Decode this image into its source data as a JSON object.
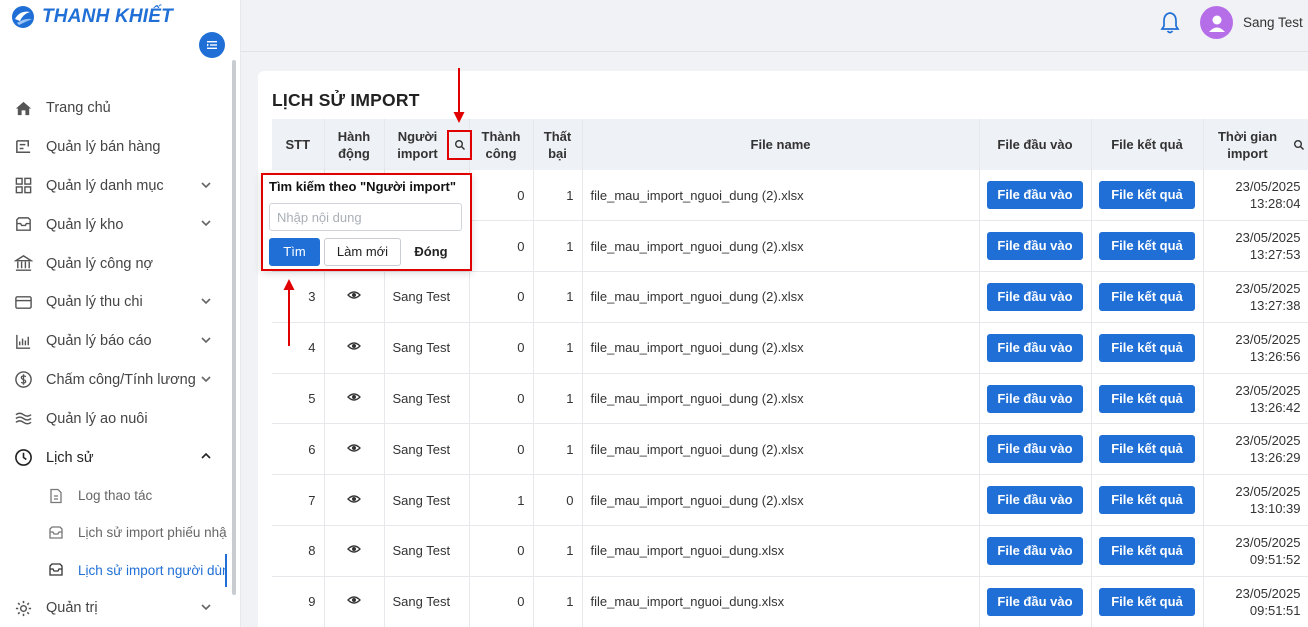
{
  "brand": {
    "name": "THANH KHIẾT"
  },
  "colors": {
    "primary": "#1f6fd6",
    "annotation": "#e00000",
    "avatar": "#b66ee8"
  },
  "header": {
    "username": "Sang Test"
  },
  "sidebar": {
    "items": [
      {
        "label": "Trang chủ",
        "icon": "home-icon",
        "chevron": false
      },
      {
        "label": "Quản lý bán hàng",
        "icon": "cart-icon",
        "chevron": false
      },
      {
        "label": "Quản lý danh mục",
        "icon": "grid-icon",
        "chevron": true
      },
      {
        "label": "Quản lý kho",
        "icon": "inbox-icon",
        "chevron": true
      },
      {
        "label": "Quản lý công nợ",
        "icon": "bank-icon",
        "chevron": false
      },
      {
        "label": "Quản lý thu chi",
        "icon": "card-icon",
        "chevron": true
      },
      {
        "label": "Quản lý báo cáo",
        "icon": "chart-icon",
        "chevron": true
      },
      {
        "label": "Chấm công/Tính lương",
        "icon": "dollar-icon",
        "chevron": true
      },
      {
        "label": "Quản lý ao nuôi",
        "icon": "wave-icon",
        "chevron": false
      },
      {
        "label": "Lịch sử",
        "icon": "history-icon",
        "chevron": true
      }
    ],
    "subitems": [
      {
        "label": "Log thao tác",
        "icon": "file-icon"
      },
      {
        "label": "Lịch sử import phiếu nhậ",
        "icon": "inbox-icon"
      },
      {
        "label": "Lịch sử import người dùr",
        "icon": "inbox-icon"
      }
    ],
    "last_item": {
      "label": "Quản trị",
      "icon": "gear-icon"
    }
  },
  "page": {
    "title": "LỊCH SỬ IMPORT",
    "columns": [
      "STT",
      "Hành động",
      "Người import",
      "Thành công",
      "Thất bại",
      "File name",
      "File đầu vào",
      "File kết quả",
      "Thời gian import"
    ],
    "columns_split": {
      "hanh_dong": [
        "Hành",
        "động"
      ],
      "nguoi_import": [
        "Người",
        "import"
      ],
      "thanh_cong": [
        "Thành",
        "công"
      ],
      "that_bai": [
        "Thất",
        "bại"
      ],
      "thoi_gian": [
        "Thời gian",
        "import"
      ]
    },
    "button_input": "File đầu vào",
    "button_result": "File kết quả",
    "rows": [
      {
        "stt": "",
        "user": "",
        "ok": "0",
        "fail": "1",
        "file": "file_mau_import_nguoi_dung (2).xlsx",
        "date": "23/05/2025",
        "time": "13:28:04"
      },
      {
        "stt": "",
        "user": "",
        "ok": "0",
        "fail": "1",
        "file": "file_mau_import_nguoi_dung (2).xlsx",
        "date": "23/05/2025",
        "time": "13:27:53"
      },
      {
        "stt": "3",
        "user": "Sang Test",
        "ok": "0",
        "fail": "1",
        "file": "file_mau_import_nguoi_dung (2).xlsx",
        "date": "23/05/2025",
        "time": "13:27:38"
      },
      {
        "stt": "4",
        "user": "Sang Test",
        "ok": "0",
        "fail": "1",
        "file": "file_mau_import_nguoi_dung (2).xlsx",
        "date": "23/05/2025",
        "time": "13:26:56"
      },
      {
        "stt": "5",
        "user": "Sang Test",
        "ok": "0",
        "fail": "1",
        "file": "file_mau_import_nguoi_dung (2).xlsx",
        "date": "23/05/2025",
        "time": "13:26:42"
      },
      {
        "stt": "6",
        "user": "Sang Test",
        "ok": "0",
        "fail": "1",
        "file": "file_mau_import_nguoi_dung (2).xlsx",
        "date": "23/05/2025",
        "time": "13:26:29"
      },
      {
        "stt": "7",
        "user": "Sang Test",
        "ok": "1",
        "fail": "0",
        "file": "file_mau_import_nguoi_dung (2).xlsx",
        "date": "23/05/2025",
        "time": "13:10:39"
      },
      {
        "stt": "8",
        "user": "Sang Test",
        "ok": "0",
        "fail": "1",
        "file": "file_mau_import_nguoi_dung.xlsx",
        "date": "23/05/2025",
        "time": "09:51:52"
      },
      {
        "stt": "9",
        "user": "Sang Test",
        "ok": "0",
        "fail": "1",
        "file": "file_mau_import_nguoi_dung.xlsx",
        "date": "23/05/2025",
        "time": "09:51:51"
      }
    ]
  },
  "filter_popup": {
    "title": "Tìm kiếm theo \"Người import\"",
    "placeholder": "Nhập nội dung",
    "value": "",
    "search_label": "Tìm",
    "reset_label": "Làm mới",
    "close_label": "Đóng"
  }
}
